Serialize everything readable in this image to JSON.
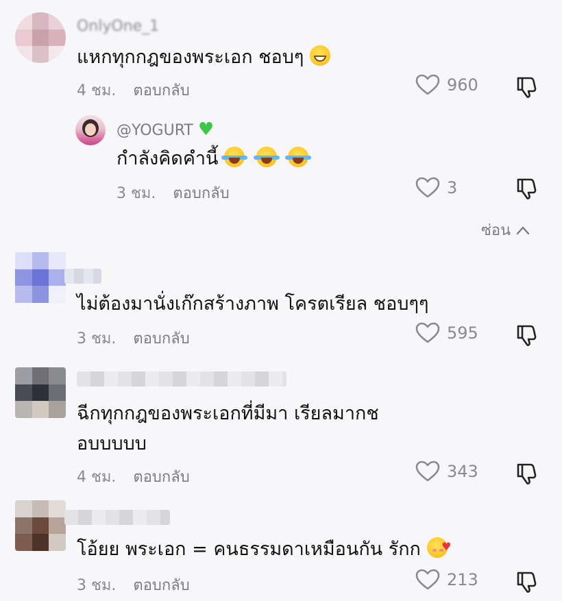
{
  "comments": [
    {
      "username": "OnlyOne_1",
      "text": "แหกทุกกฎของพระเอก ชอบๆ",
      "emoji": "grinning-face",
      "time": "4 ชม.",
      "reply_label": "ตอบกลับ",
      "likes": "960",
      "avatar_colors": [
        "#f0dde2",
        "#d8b7c1",
        "#ead2da",
        "#e9c9d2",
        "#c9a1ad",
        "#d7b2bd",
        "#f1e3e8",
        "#dcc0c8",
        "#f3e8ec"
      ],
      "reply": {
        "username": "@YOGURT",
        "username_emoji": "green-heart",
        "text": "กำลังคิดคำนี้",
        "emoji": "tears-of-joy",
        "time": "3 ชม.",
        "reply_label": "ตอบกลับ",
        "likes": "3"
      },
      "hide_label": "ซ่อน"
    },
    {
      "text": "ไม่ต้องมานั่งเก๊กสร้างภาพ โครตเรียล ชอบๆๆ",
      "time": "3 ชม.",
      "reply_label": "ตอบกลับ",
      "likes": "595",
      "avatar_colors": [
        "#dcdff7",
        "#b5bbef",
        "#e8e9f8",
        "#8d94e0",
        "#6b74d6",
        "#aab0ec",
        "#b7bced",
        "#8c93df",
        "#eef0fb"
      ]
    },
    {
      "text_line1": "ฉีกทุกกฎของพระเอกที่มีมา เรียลมากช",
      "text_line2": "อบบบบบ",
      "time": "4 ชม.",
      "reply_label": "ตอบกลับ",
      "likes": "343",
      "avatar_colors": [
        "#9d9ea3",
        "#6f6f73",
        "#8b8c90",
        "#4a4c55",
        "#2f3039",
        "#6c6e76",
        "#b9b5b2",
        "#d2c9c1",
        "#a9a19b"
      ]
    },
    {
      "text": "โอ้ยย พระเอก = คนธรรมดาเหมือนกัน รักก",
      "emoji": "smiling-face-with-hearts",
      "time": "3 ชม.",
      "reply_label": "ตอบกลับ",
      "likes": "213",
      "avatar_colors": [
        "#d9d3cf",
        "#c7bcb4",
        "#e1dcd8",
        "#8d7468",
        "#6a4a3c",
        "#b7a399",
        "#7c5c4e",
        "#4e3328",
        "#d3c9c3"
      ]
    }
  ],
  "icons": {
    "like": "heart-outline-icon",
    "dislike": "thumbs-down-icon",
    "hide": "chevron-up-icon"
  },
  "colors": {
    "background": "#f7f7f9",
    "text": "#111111",
    "muted": "#8a8a8e"
  }
}
